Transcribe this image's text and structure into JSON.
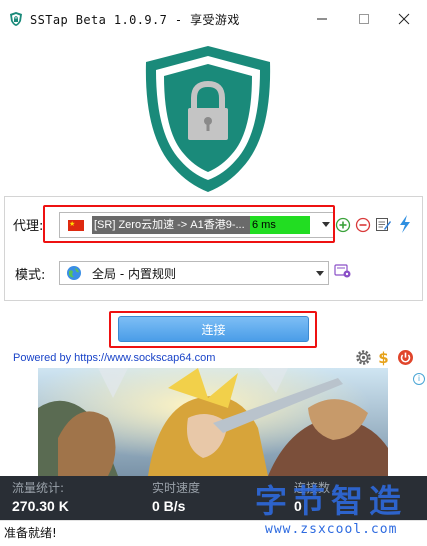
{
  "window": {
    "title": "SSTap Beta 1.0.9.7 - 享受游戏",
    "controls": [
      "minimize-icon",
      "maximize-icon",
      "close-icon"
    ]
  },
  "shield": {
    "icon": "lock-shield-icon",
    "colors": {
      "teal": "#1a8a7a",
      "lock": "#bdbdbd"
    }
  },
  "proxy": {
    "label": "代理:",
    "flag": "china-flag-icon",
    "selected": "[SR] Zero云加速 -> A1香港9-...",
    "latency": "6 ms",
    "tools": [
      "add-icon",
      "remove-icon",
      "edit-icon",
      "flash-icon"
    ]
  },
  "mode": {
    "label": "模式:",
    "icon": "globe-icon",
    "selected": "全局 - 内置规则",
    "tool": "mode-settings-icon"
  },
  "connect": {
    "label": "连接"
  },
  "footer_links": {
    "powered": "Powered by https://www.sockscap64.com",
    "icons": [
      "gear-icon",
      "dollar-icon",
      "power-icon"
    ]
  },
  "ad": {
    "info_label": "i"
  },
  "stats": {
    "traffic_label": "流量统计:",
    "traffic_value": "270.30 K",
    "speed_label": "实时速度",
    "speed_value": "0 B/s",
    "connections_label": "连接数",
    "connections_value": "0"
  },
  "watermark": {
    "text": "字节智造",
    "url": "www.zsxcool.com"
  },
  "status": {
    "text": "准备就绪!"
  },
  "colors": {
    "accent": "#4a9de8",
    "highlight": "#e11111",
    "ping_bg": "#22dd22",
    "link": "#1a44c8"
  }
}
